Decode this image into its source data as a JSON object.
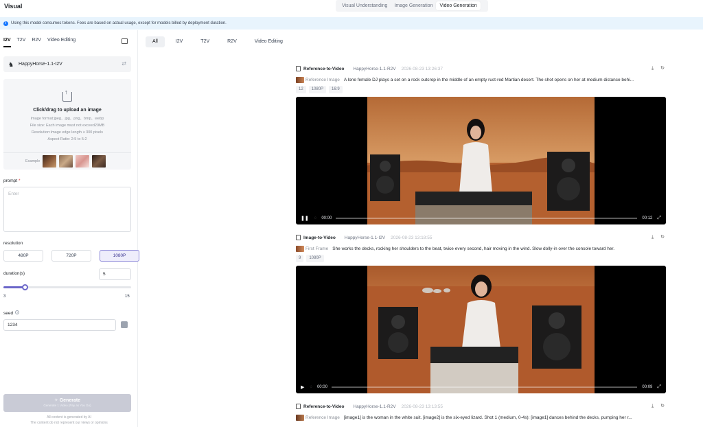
{
  "app": {
    "title": "Visual"
  },
  "top_tabs": [
    {
      "label": "Visual Understanding",
      "active": false
    },
    {
      "label": "Image Generation",
      "active": false
    },
    {
      "label": "Video Generation",
      "active": true
    }
  ],
  "notice": {
    "text": "Using this model consumes tokens. Fees are based on actual usage, except for models billed by deployment duration.",
    "icon": "info-icon"
  },
  "left": {
    "mode_tabs": [
      {
        "label": "I2V",
        "active": true
      },
      {
        "label": "T2V",
        "active": false
      },
      {
        "label": "R2V",
        "active": false
      },
      {
        "label": "Video Editing",
        "active": false
      }
    ],
    "model": {
      "name": "HappyHorse-1.1-I2V"
    },
    "upload": {
      "title": "Click/drag to upload an image",
      "lines": [
        "Image format:jpeg、jpg、png、bmp、webp",
        "File size: Each image must not exceed20MB",
        "Resolution:Image edge length ≥ 300 pixels",
        "Aspect Ratio: 2:5 to 5:2"
      ],
      "example_label": "Example"
    },
    "prompt": {
      "label": "prompt",
      "required": "*",
      "placeholder": "Enter"
    },
    "resolution": {
      "label": "resolution",
      "options": [
        "480P",
        "720P",
        "1080P"
      ],
      "selected": "1080P"
    },
    "duration": {
      "label": "duration(s)",
      "value": "5",
      "min": "3",
      "max": "15",
      "level": 0.1667
    },
    "seed": {
      "label": "seed",
      "value": "1234"
    },
    "generate": {
      "label": "Generate",
      "sub": "Generate 1 Video (Pay as You Go)"
    },
    "footer": [
      "All content is generated by AI",
      "The content do not represent our views or opinions"
    ]
  },
  "filters": [
    {
      "label": "All",
      "active": true
    },
    {
      "label": "I2V",
      "active": false
    },
    {
      "label": "T2V",
      "active": false
    },
    {
      "label": "R2V",
      "active": false
    },
    {
      "label": "Video Editing",
      "active": false
    }
  ],
  "cards": [
    {
      "type": "Reference-to-Video",
      "model": "HappyHorse-1.1-R2V",
      "time": "2026-08-23 13:26:37",
      "ref_label": "Reference Image",
      "desc": "A lone female DJ plays a set on a rock outcrop in the middle of an empty rust-red Martian desert. The shot opens on her at medium distance behi...",
      "tags": [
        "12",
        "1080P",
        "16:9"
      ],
      "video": {
        "current": "00:00",
        "duration": "00:12",
        "play_icon": "pause-icon"
      }
    },
    {
      "type": "Image-to-Video",
      "model": "HappyHorse-1.1-I2V",
      "time": "2026-08-23 13:18:55",
      "ref_label": "First Frame",
      "desc": "She works the decks, rocking her shoulders to the beat, twice every second, hair moving in the wind. Slow dolly-in over the console toward her.",
      "tags": [
        "9",
        "1080P"
      ],
      "video": {
        "current": "00:00",
        "duration": "00:09",
        "play_icon": "play-icon"
      }
    },
    {
      "type": "Reference-to-Video",
      "model": "HappyHorse-1.1-R2V",
      "time": "2026-08-23 13:13:55",
      "ref_label": "Reference Image",
      "desc": "[image1] is the woman in the white suit. [image2] is the six-eyed lizard. Shot 1 (medium, 0-4s): [image1] dances behind the decks, pumping her r...",
      "tags": []
    }
  ],
  "colors": {
    "accent": "#6b66c9",
    "notice_bg": "#e8f4fd",
    "info": "#1677ff",
    "generate_disabled": "#c9cbd6"
  }
}
